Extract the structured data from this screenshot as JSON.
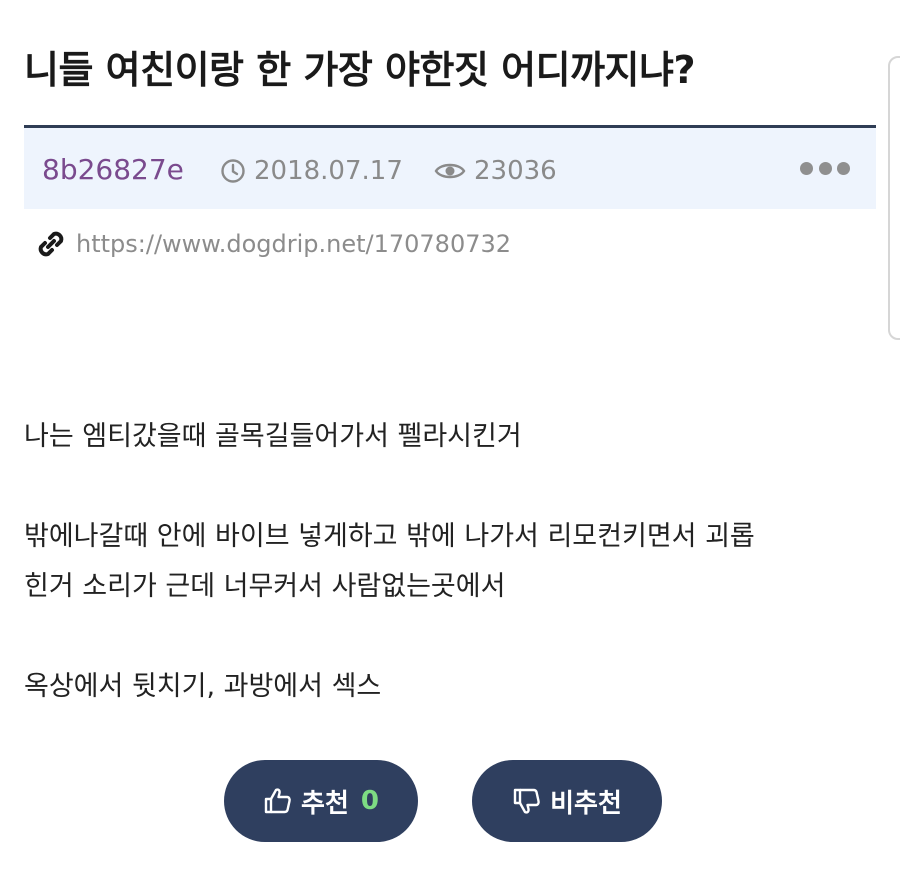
{
  "post": {
    "title": "니들 여친이랑 한 가장 야한짓 어디까지냐?",
    "author": "8b26827e",
    "date": "2018.07.17",
    "views": "23036",
    "url": "https://www.dogdrip.net/170780732",
    "body": [
      "나는 엠티갔을때 골목길들어가서 펠라시킨거",
      "밖에나갈때 안에 바이브 넣게하고 밖에 나가서 리모컨키면서 괴롭",
      "힌거 소리가 근데 너무커서 사람없는곳에서",
      "옥상에서 뒷치기, 과방에서 섹스"
    ]
  },
  "votes": {
    "up_label": "추천",
    "up_count": "0",
    "down_label": "비추천",
    "up_count_color": "#7ddc83"
  },
  "icons": {
    "date": "clock-icon",
    "views": "eye-icon",
    "url": "link-icon",
    "more": "more-dots-icon",
    "up": "thumbs-up-icon",
    "down": "thumbs-down-icon"
  },
  "colors": {
    "author": "#7a4a8e",
    "meta_bg": "#eef4fd",
    "meta_border": "#2f3d55",
    "button_bg": "#2f3f5f"
  }
}
